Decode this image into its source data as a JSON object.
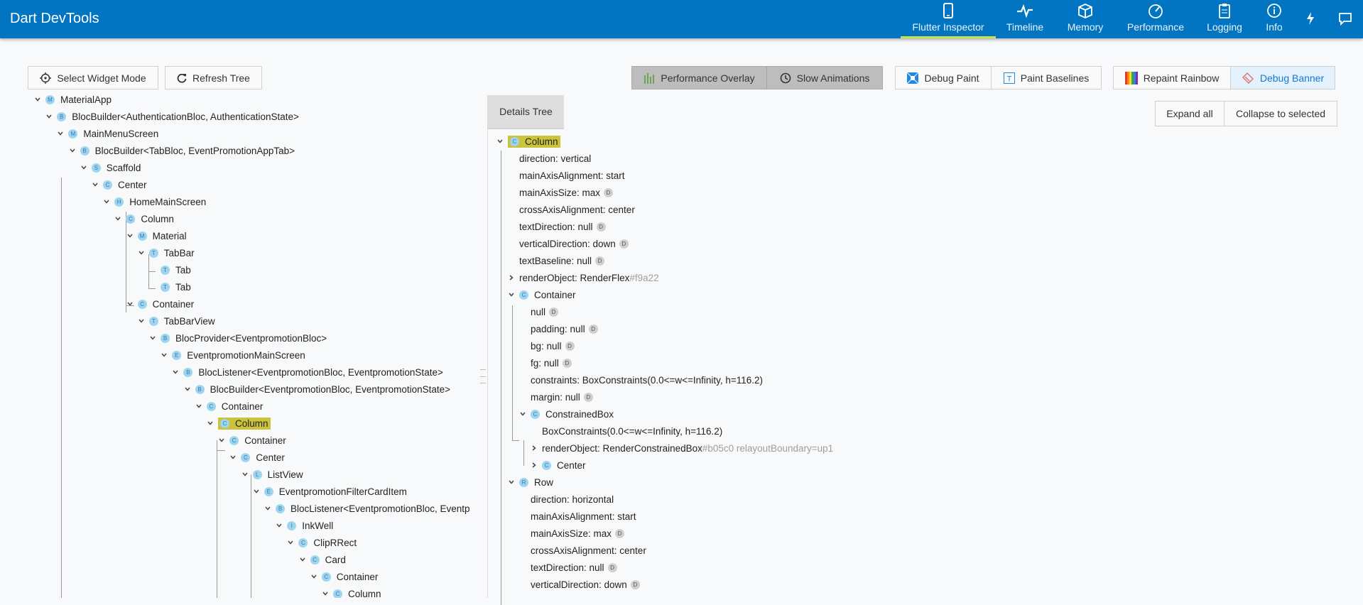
{
  "header": {
    "title": "Dart DevTools",
    "tabs": [
      {
        "label": "Flutter Inspector",
        "icon": "phone-icon",
        "active": true
      },
      {
        "label": "Timeline",
        "icon": "pulse-icon"
      },
      {
        "label": "Memory",
        "icon": "box-icon"
      },
      {
        "label": "Performance",
        "icon": "speedometer-icon"
      },
      {
        "label": "Logging",
        "icon": "clipboard-icon"
      },
      {
        "label": "Info",
        "icon": "info-icon"
      }
    ],
    "extra_icons": [
      "flash-icon",
      "feedback-icon"
    ]
  },
  "toolbar": {
    "select_widget_mode": "Select Widget Mode",
    "refresh_tree": "Refresh Tree",
    "performance_overlay": "Performance Overlay",
    "slow_animations": "Slow Animations",
    "debug_paint": "Debug Paint",
    "paint_baselines": "Paint Baselines",
    "repaint_rainbow": "Repaint Rainbow",
    "debug_banner": "Debug Banner"
  },
  "widget_tree": [
    {
      "badge": "M",
      "label": "MaterialApp"
    },
    {
      "badge": "B",
      "label": "BlocBuilder<AuthenticationBloc, AuthenticationState>"
    },
    {
      "badge": "M",
      "label": "MainMenuScreen"
    },
    {
      "badge": "B",
      "label": "BlocBuilder<TabBloc, EventPromotionAppTab>"
    },
    {
      "badge": "S",
      "label": "Scaffold"
    },
    {
      "badge": "C",
      "label": "Center"
    },
    {
      "badge": "H",
      "label": "HomeMainScreen"
    },
    {
      "badge": "C",
      "label": "Column"
    },
    {
      "badge": "M",
      "label": "Material"
    },
    {
      "badge": "T",
      "label": "TabBar"
    },
    {
      "badge": "T",
      "label": "Tab"
    },
    {
      "badge": "T",
      "label": "Tab"
    },
    {
      "badge": "C",
      "label": "Container"
    },
    {
      "badge": "T",
      "label": "TabBarView"
    },
    {
      "badge": "B",
      "label": "BlocProvider<EventpromotionBloc>"
    },
    {
      "badge": "E",
      "label": "EventpromotionMainScreen"
    },
    {
      "badge": "B",
      "label": "BlocListener<EventpromotionBloc, EventpromotionState>"
    },
    {
      "badge": "B",
      "label": "BlocBuilder<EventpromotionBloc, EventpromotionState>"
    },
    {
      "badge": "C",
      "label": "Container"
    },
    {
      "badge": "C",
      "label": "Column",
      "selected": true
    },
    {
      "badge": "C",
      "label": "Container"
    },
    {
      "badge": "C",
      "label": "Center"
    },
    {
      "badge": "L",
      "label": "ListView"
    },
    {
      "badge": "E",
      "label": "EventpromotionFilterCardItem"
    },
    {
      "badge": "B",
      "label": "BlocListener<EventpromotionBloc, Eventp"
    },
    {
      "badge": "I",
      "label": "InkWell"
    },
    {
      "badge": "C",
      "label": "ClipRRect"
    },
    {
      "badge": "C",
      "label": "Card"
    },
    {
      "badge": "C",
      "label": "Container"
    },
    {
      "badge": "C",
      "label": "Column"
    }
  ],
  "details": {
    "tab_label": "Details Tree",
    "expand_all": "Expand all",
    "collapse_to_selected": "Collapse to selected",
    "default_flag": "D",
    "rows": [
      {
        "badge": "C",
        "label": "Column",
        "selected": true
      },
      {
        "text": "direction: vertical"
      },
      {
        "text": "mainAxisAlignment: start"
      },
      {
        "text": "mainAxisSize: max",
        "flag": true
      },
      {
        "text": "crossAxisAlignment: center"
      },
      {
        "text": "textDirection: null",
        "flag": true
      },
      {
        "text": "verticalDirection: down",
        "flag": true
      },
      {
        "text": "textBaseline: null",
        "flag": true
      },
      {
        "text": "renderObject: RenderFlex",
        "gray": "#f9a22"
      },
      {
        "badge": "C",
        "label": "Container"
      },
      {
        "text": "null",
        "flag": true
      },
      {
        "text": "padding: null",
        "flag": true
      },
      {
        "text": "bg: null",
        "flag": true
      },
      {
        "text": "fg: null",
        "flag": true
      },
      {
        "text": "constraints: BoxConstraints(0.0<=w<=Infinity, h=116.2)"
      },
      {
        "text": "margin: null",
        "flag": true
      },
      {
        "badge": "C",
        "label": "ConstrainedBox"
      },
      {
        "text": "BoxConstraints(0.0<=w<=Infinity, h=116.2)"
      },
      {
        "text": "renderObject: RenderConstrainedBox",
        "gray": "#b05c0 relayoutBoundary=up1"
      },
      {
        "badge": "C",
        "label": "Center"
      },
      {
        "badge": "R",
        "label": "Row"
      },
      {
        "text": "direction: horizontal"
      },
      {
        "text": "mainAxisAlignment: start"
      },
      {
        "text": "mainAxisSize: max",
        "flag": true
      },
      {
        "text": "crossAxisAlignment: center"
      },
      {
        "text": "textDirection: null",
        "flag": true
      },
      {
        "text": "verticalDirection: down",
        "flag": true
      }
    ]
  },
  "colors": {
    "header_bg": "#0175c2",
    "selection_highlight": "#cbc43b",
    "badge_bg": "#9fd3ee",
    "active_tab_underline": "#c6e04f"
  }
}
